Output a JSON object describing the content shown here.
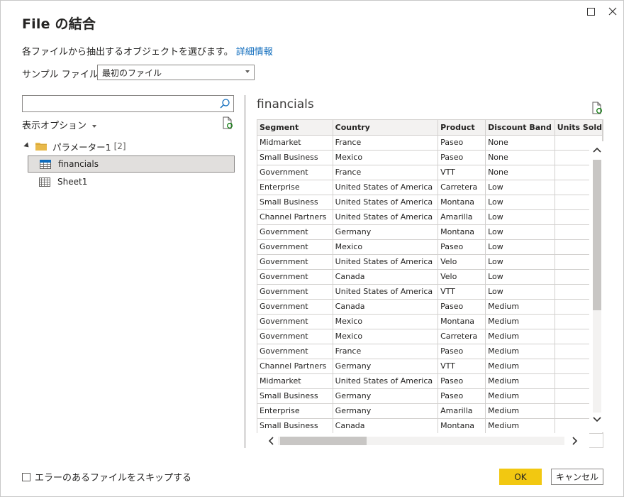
{
  "dialog": {
    "title": "File の結合",
    "description": "各ファイルから抽出するオブジェクトを選びます。",
    "info_link": "詳細情報"
  },
  "sample_file": {
    "label": "サンプル ファイル:",
    "selected": "最初のファイル"
  },
  "navigator": {
    "search_placeholder": "",
    "display_options": "表示オプション",
    "parameter": {
      "label": "パラメーター1",
      "count": "[2]"
    },
    "items": [
      {
        "label": "financials",
        "selected": true,
        "icon": "table-icon"
      },
      {
        "label": "Sheet1",
        "selected": false,
        "icon": "sheet-icon"
      }
    ]
  },
  "preview": {
    "title": "financials",
    "columns": [
      "Segment",
      "Country",
      "Product",
      "Discount Band",
      "Units Sold"
    ],
    "rows": [
      [
        "Midmarket",
        "France",
        "Paseo",
        "None"
      ],
      [
        "Small Business",
        "Mexico",
        "Paseo",
        "None"
      ],
      [
        "Government",
        "France",
        "VTT",
        "None"
      ],
      [
        "Enterprise",
        "United States of America",
        "Carretera",
        "Low"
      ],
      [
        "Small Business",
        "United States of America",
        "Montana",
        "Low"
      ],
      [
        "Channel Partners",
        "United States of America",
        "Amarilla",
        "Low"
      ],
      [
        "Government",
        "Germany",
        "Montana",
        "Low"
      ],
      [
        "Government",
        "Mexico",
        "Paseo",
        "Low"
      ],
      [
        "Government",
        "United States of America",
        "Velo",
        "Low"
      ],
      [
        "Government",
        "Canada",
        "Velo",
        "Low"
      ],
      [
        "Government",
        "United States of America",
        "VTT",
        "Low"
      ],
      [
        "Government",
        "Canada",
        "Paseo",
        "Medium"
      ],
      [
        "Government",
        "Mexico",
        "Montana",
        "Medium"
      ],
      [
        "Government",
        "Mexico",
        "Carretera",
        "Medium"
      ],
      [
        "Government",
        "France",
        "Paseo",
        "Medium"
      ],
      [
        "Channel Partners",
        "Germany",
        "VTT",
        "Medium"
      ],
      [
        "Midmarket",
        "United States of America",
        "Paseo",
        "Medium"
      ],
      [
        "Small Business",
        "Germany",
        "Paseo",
        "Medium"
      ],
      [
        "Enterprise",
        "Germany",
        "Amarilla",
        "Medium"
      ],
      [
        "Small Business",
        "Canada",
        "Montana",
        "Medium"
      ]
    ]
  },
  "footer": {
    "skip_errors_label": "エラーのあるファイルをスキップする",
    "ok_label": "OK",
    "cancel_label": "キャンセル"
  },
  "colors": {
    "accent": "#f2c811",
    "link": "#0f6cbd",
    "selection": "#e1dfdd",
    "folder": "#e8b94a"
  }
}
